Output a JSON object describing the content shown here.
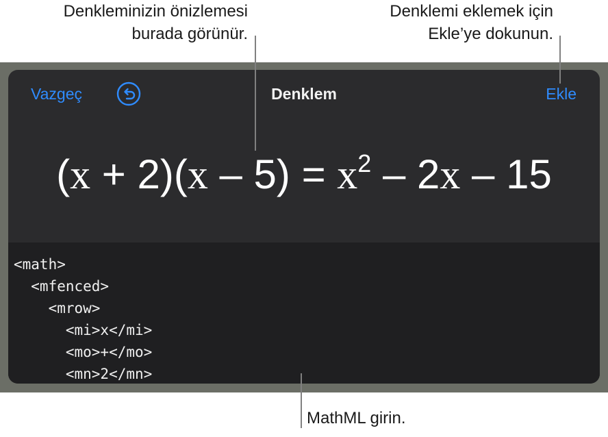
{
  "callouts": {
    "preview": [
      "Denkleminizin önizlemesi",
      "burada görünür."
    ],
    "insert": [
      "Denklemi eklemek için",
      "Ekle’ye dokunun."
    ],
    "mathml": "MathML girin."
  },
  "dialog": {
    "cancel_label": "Vazgeç",
    "title": "Denklem",
    "insert_label": "Ekle"
  },
  "preview": {
    "equation_parts": [
      "(",
      "x",
      " + 2)(",
      "x",
      " – 5) = ",
      "x",
      "2",
      " – 2",
      "x",
      " – 15"
    ]
  },
  "editor": {
    "code_lines": [
      "<math>",
      "  <mfenced>",
      "    <mrow>",
      "      <mi>x</mi>",
      "      <mo>+</mo>",
      "      <mn>2</mn>"
    ]
  },
  "colors": {
    "accent": "#2f8cff",
    "sheet_background": "#2b2b2d",
    "editor_background": "#1f1f21",
    "frame": "#6b6e66"
  },
  "icons": {
    "undo": "undo-icon"
  }
}
